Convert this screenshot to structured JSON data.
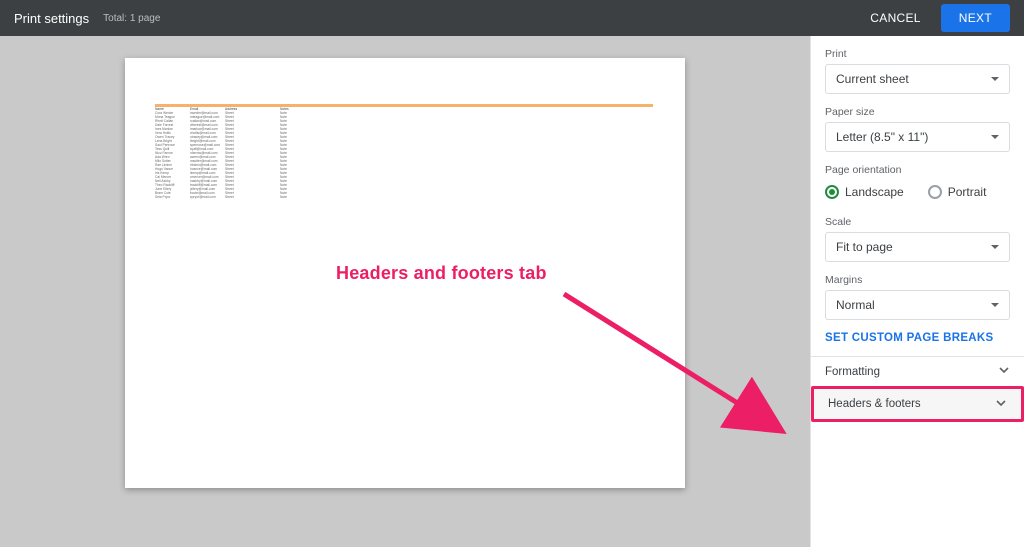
{
  "topbar": {
    "title": "Print settings",
    "total": "Total: 1 page",
    "cancel": "CANCEL",
    "next": "NEXT"
  },
  "annotation": {
    "text": "Headers and footers tab"
  },
  "sidebar": {
    "print_label": "Print",
    "print_value": "Current sheet",
    "paper_label": "Paper size",
    "paper_value": "Letter (8.5\" x 11\")",
    "orientation_label": "Page orientation",
    "orientation_landscape": "Landscape",
    "orientation_portrait": "Portrait",
    "scale_label": "Scale",
    "scale_value": "Fit to page",
    "margins_label": "Margins",
    "margins_value": "Normal",
    "set_custom_breaks": "SET CUSTOM PAGE BREAKS",
    "accordion_formatting": "Formatting",
    "accordion_headers": "Headers & footers"
  },
  "preview_sheet": {
    "headers": [
      "Name",
      "Email",
      "Address",
      "Notes"
    ],
    "rows": [
      [
        "Cora Wexler",
        "cwexler@mail.com",
        "Street",
        "Note"
      ],
      [
        "Mona Teague",
        "mteague@mail.com",
        "Street",
        "Note"
      ],
      [
        "Rhett Callan",
        "rcallan@mail.com",
        "Street",
        "Note"
      ],
      [
        "Dale Forrest",
        "dforrest@mail.com",
        "Street",
        "Note"
      ],
      [
        "Ines Marlow",
        "imarlow@mail.com",
        "Street",
        "Note"
      ],
      [
        "Vera Hollis",
        "vhollis@mail.com",
        "Street",
        "Note"
      ],
      [
        "Owen Tracey",
        "otracey@mail.com",
        "Street",
        "Note"
      ],
      [
        "Lena Bright",
        "lbright@mail.com",
        "Street",
        "Note"
      ],
      [
        "Saul Penrose",
        "spenrose@mail.com",
        "Street",
        "Note"
      ],
      [
        "Tess Quill",
        "tquill@mail.com",
        "Street",
        "Note"
      ],
      [
        "Nico Farrow",
        "nfarrow@mail.com",
        "Street",
        "Note"
      ],
      [
        "Ada Wren",
        "awren@mail.com",
        "Street",
        "Note"
      ],
      [
        "Milo Sutter",
        "msutter@mail.com",
        "Street",
        "Note"
      ],
      [
        "Rae Linden",
        "rlinden@mail.com",
        "Street",
        "Note"
      ],
      [
        "Hugo Vance",
        "hvance@mail.com",
        "Street",
        "Note"
      ],
      [
        "Iris Kemp",
        "ikemp@mail.com",
        "Street",
        "Note"
      ],
      [
        "Cal Mercer",
        "cmercer@mail.com",
        "Street",
        "Note"
      ],
      [
        "Nell Ashby",
        "nashby@mail.com",
        "Street",
        "Note"
      ],
      [
        "Theo Radcliff",
        "tradcliff@mail.com",
        "Street",
        "Note"
      ],
      [
        "June Ellery",
        "jellery@mail.com",
        "Street",
        "Note"
      ],
      [
        "Bram Cote",
        "bcote@mail.com",
        "Street",
        "Note"
      ],
      [
        "Sela Pryor",
        "spryor@mail.com",
        "Street",
        "Note"
      ]
    ]
  }
}
